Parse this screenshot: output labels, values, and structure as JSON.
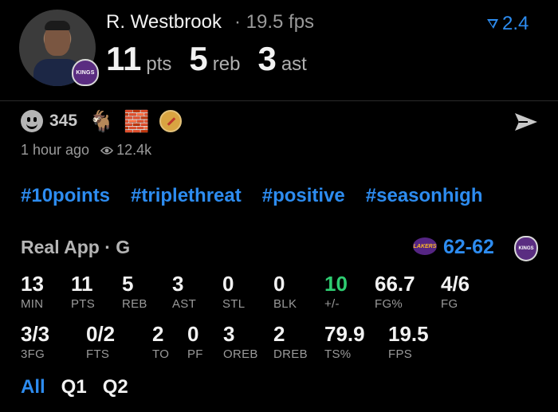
{
  "player": {
    "name": "R. Westbrook",
    "fps_label": "· 19.5 fps",
    "pts": "11",
    "pts_unit": "pts",
    "reb": "5",
    "reb_unit": "reb",
    "ast": "3",
    "ast_unit": "ast",
    "team_badge_text": "KINGS"
  },
  "rating": {
    "value": "2.4",
    "icon": "real-logo-icon",
    "color": "#2d8cf0"
  },
  "reactions": {
    "count": "345",
    "emojis": [
      "🐐",
      "🧱"
    ],
    "icons": [
      "smiley-icon",
      "goat-icon",
      "brick-icon",
      "compass-icon"
    ]
  },
  "post": {
    "time": "1 hour ago",
    "views": "12.4k"
  },
  "hashtags": [
    "#10points",
    "#triplethreat",
    "#positive",
    "#seasonhigh"
  ],
  "game": {
    "source": "Real App · G",
    "away_team_badge": "LAKERS",
    "home_team_badge": "KINGS",
    "score": "62-62"
  },
  "stats_row1": [
    {
      "value": "13",
      "label": "MIN"
    },
    {
      "value": "11",
      "label": "PTS"
    },
    {
      "value": "5",
      "label": "REB"
    },
    {
      "value": "3",
      "label": "AST"
    },
    {
      "value": "0",
      "label": "STL"
    },
    {
      "value": "0",
      "label": "BLK"
    },
    {
      "value": "10",
      "label": "+/-"
    },
    {
      "value": "66.7",
      "label": "FG%"
    },
    {
      "value": "4/6",
      "label": "FG"
    }
  ],
  "stats_row2": [
    {
      "value": "3/3",
      "label": "3FG"
    },
    {
      "value": "0/2",
      "label": "FTS"
    },
    {
      "value": "2",
      "label": "TO"
    },
    {
      "value": "0",
      "label": "PF"
    },
    {
      "value": "3",
      "label": "OREB"
    },
    {
      "value": "2",
      "label": "DREB"
    },
    {
      "value": "79.9",
      "label": "TS%"
    },
    {
      "value": "19.5",
      "label": "FPS"
    }
  ],
  "period_tabs": [
    "All",
    "Q1",
    "Q2"
  ],
  "colors": {
    "accent": "#2d8cf0",
    "positive": "#2ecc71",
    "background": "#000000"
  }
}
